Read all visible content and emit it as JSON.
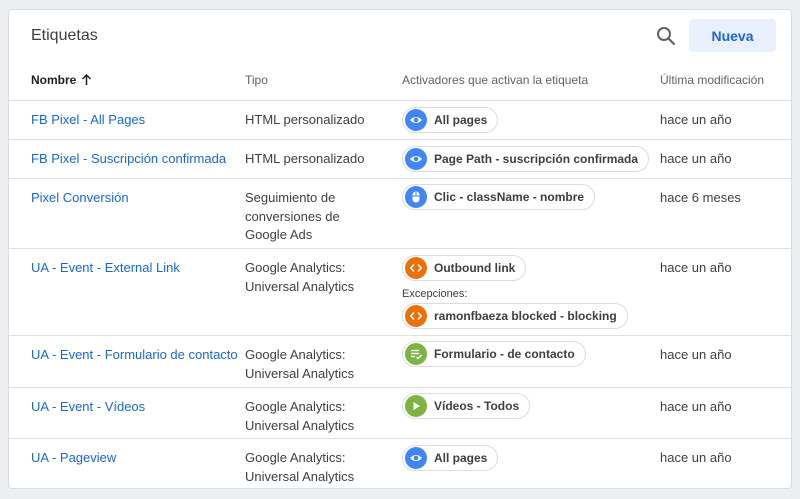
{
  "header": {
    "title": "Etiquetas",
    "new_label": "Nueva"
  },
  "columns": {
    "name": "Nombre",
    "type": "Tipo",
    "triggers": "Activadores que activan la etiqueta",
    "modified": "Última modificación"
  },
  "exceptions_label": "Excepciones:",
  "rows": [
    {
      "name": "FB Pixel - All Pages",
      "type": "HTML personalizado",
      "trigger": "All pages",
      "modified": "hace un año"
    },
    {
      "name": "FB Pixel - Suscripción confirmada",
      "type": "HTML personalizado",
      "trigger": "Page Path - suscripción confirmada",
      "modified": "hace un año"
    },
    {
      "name": "Pixel Conversión",
      "type": "Seguimiento de conversiones de Google Ads",
      "trigger": "Clic - className - nombre",
      "modified": "hace 6 meses"
    },
    {
      "name": "UA - Event - External Link",
      "type": "Google Analytics: Universal Analytics",
      "trigger": "Outbound link",
      "exception": "ramonfbaeza blocked - blocking",
      "modified": "hace un año"
    },
    {
      "name": "UA - Event - Formulario de contacto",
      "type": "Google Analytics: Universal Analytics",
      "trigger": "Formulario - de contacto",
      "modified": "hace un año"
    },
    {
      "name": "UA - Event - Vídeos",
      "type": "Google Analytics: Universal Analytics",
      "trigger": "Vídeos - Todos",
      "modified": "hace un año"
    },
    {
      "name": "UA - Pageview",
      "type": "Google Analytics: Universal Analytics",
      "trigger": "All pages",
      "modified": "hace un año"
    }
  ],
  "icons": {
    "page_view": "eye-icon",
    "click": "mouse-icon",
    "link": "code-brackets-icon",
    "form": "form-icon",
    "video": "play-icon"
  },
  "colors": {
    "accent": "#1967d2",
    "page_view": "#4285f4",
    "click": "#4285f4",
    "link": "#e8710a",
    "form": "#7cb342",
    "video": "#7cb342"
  }
}
